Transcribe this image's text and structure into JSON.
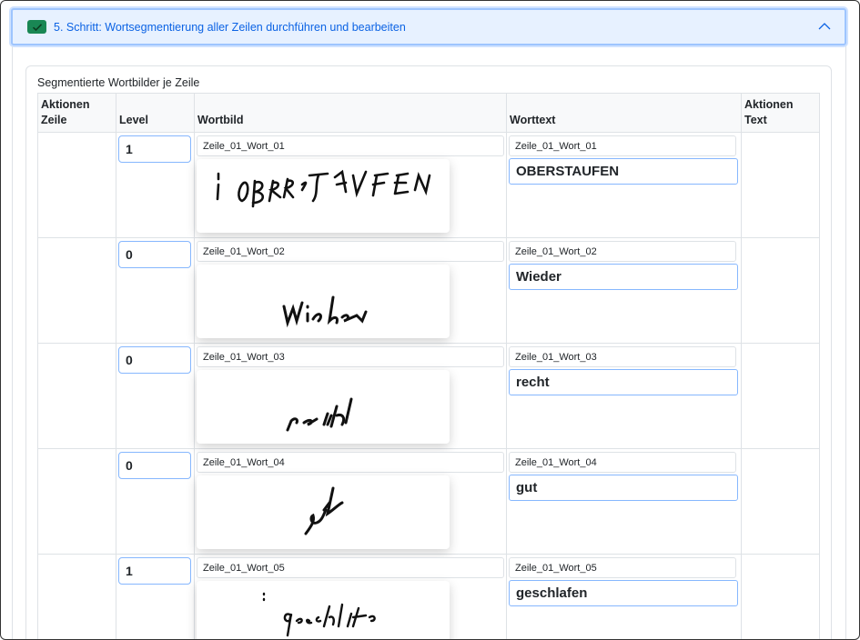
{
  "accordion": {
    "title": "5. Schritt: Wortsegmentierung aller Zeilen durchführen und bearbeiten",
    "icon": "check-icon",
    "chevron_icon": "chevron-up-icon"
  },
  "card": {
    "title": "Segmentierte Wortbilder je Zeile"
  },
  "table": {
    "headers": {
      "actions_line_1": "Aktionen",
      "actions_line_2": "Zeile",
      "level": "Level",
      "word_image": "Wortbild",
      "word_text": "Worttext",
      "actions_text": "Aktionen Text"
    },
    "rows": [
      {
        "level": "1",
        "image_name": "Zeile_01_Wort_01",
        "text_name": "Zeile_01_Wort_01",
        "text_value": "OBERSTAUFEN"
      },
      {
        "level": "0",
        "image_name": "Zeile_01_Wort_02",
        "text_name": "Zeile_01_Wort_02",
        "text_value": "Wieder"
      },
      {
        "level": "0",
        "image_name": "Zeile_01_Wort_03",
        "text_name": "Zeile_01_Wort_03",
        "text_value": "recht"
      },
      {
        "level": "0",
        "image_name": "Zeile_01_Wort_04",
        "text_name": "Zeile_01_Wort_04",
        "text_value": "gut"
      },
      {
        "level": "1",
        "image_name": "Zeile_01_Wort_05",
        "text_name": "Zeile_01_Wort_05",
        "text_value": "geschlafen"
      }
    ]
  },
  "colors": {
    "accent": "#0c63e4",
    "success": "#198754",
    "header_bg": "#e7f1ff"
  }
}
